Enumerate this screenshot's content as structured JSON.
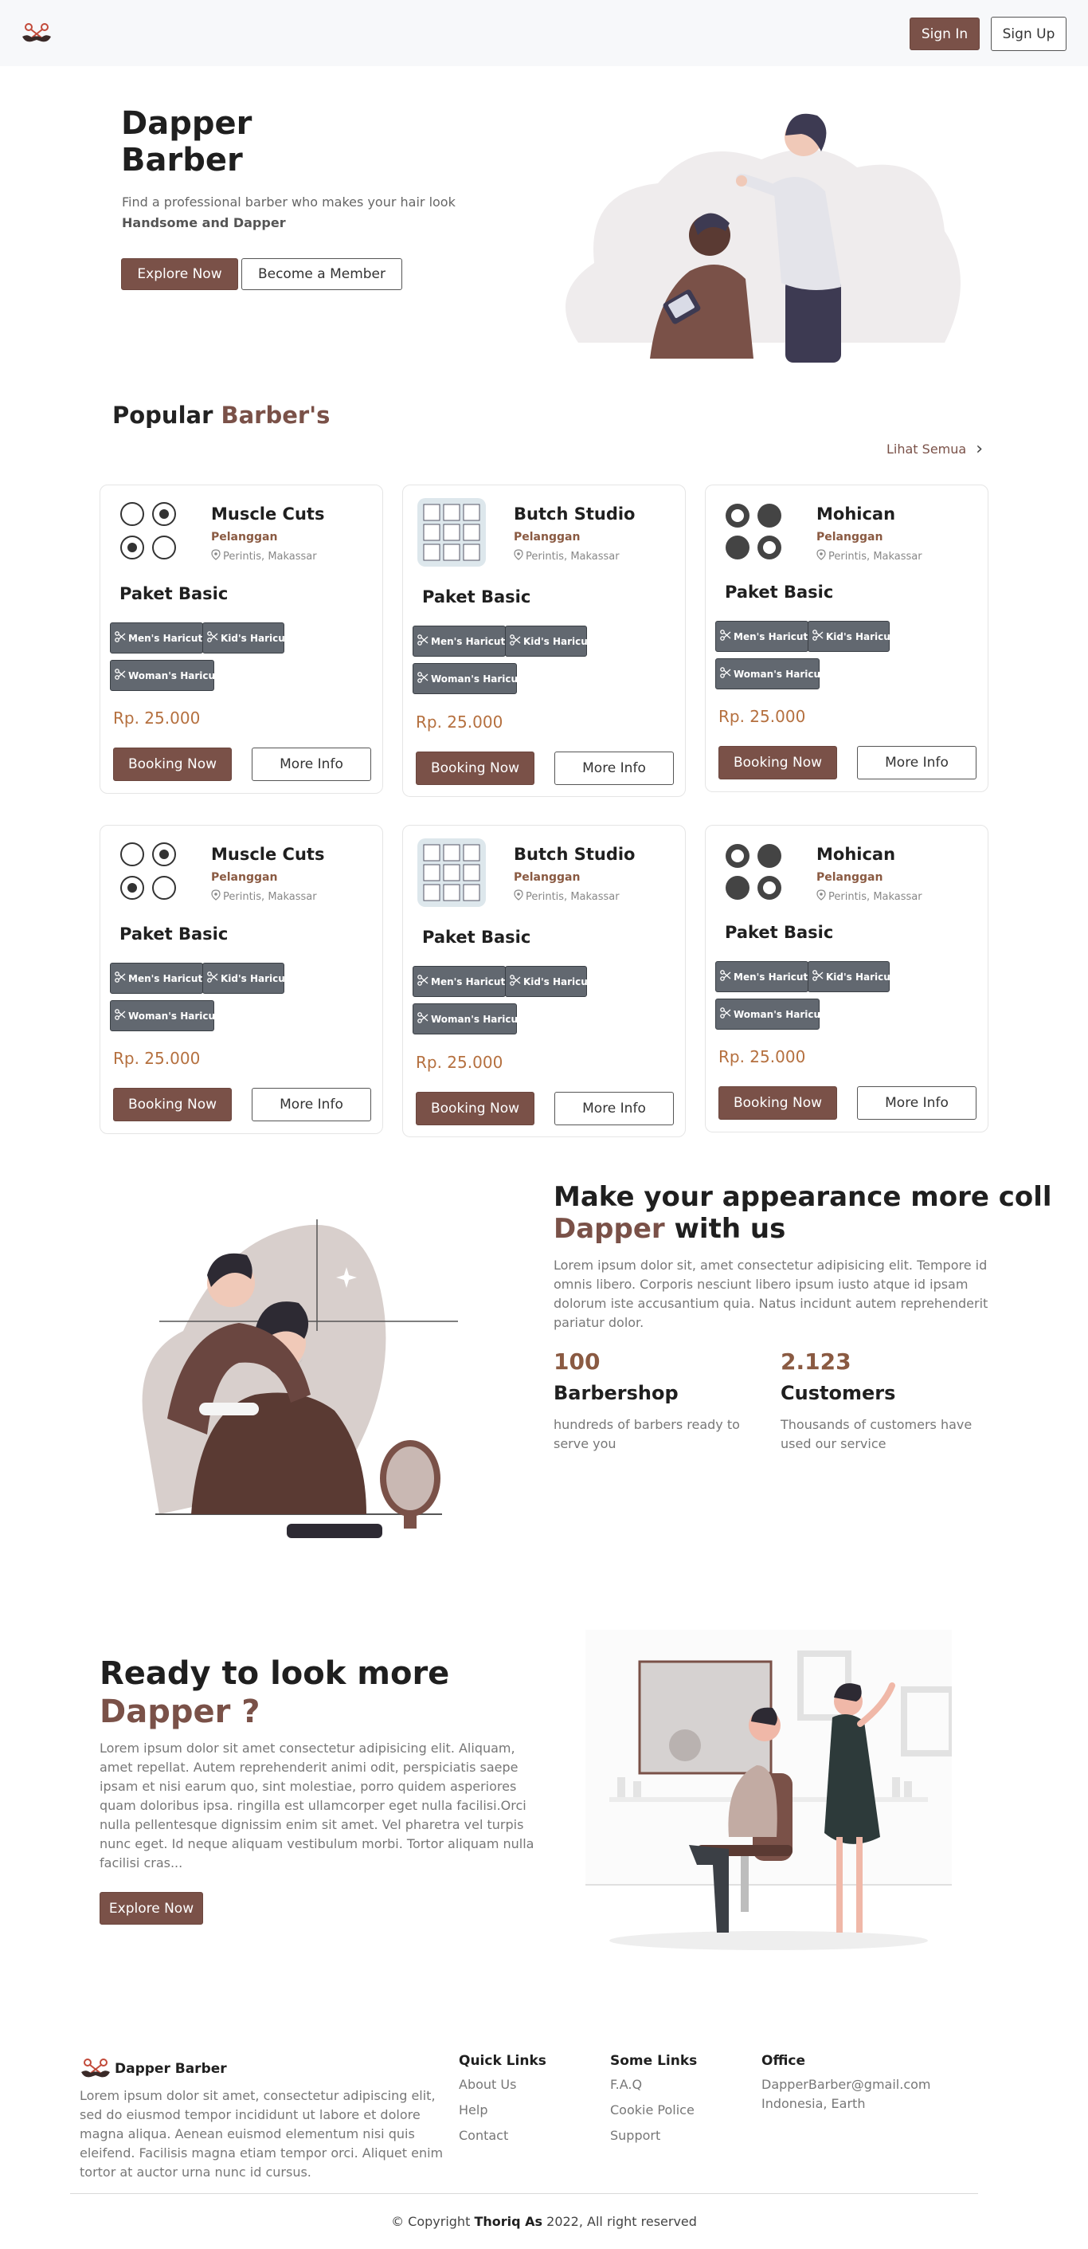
{
  "nav": {
    "signin_label": "Sign In",
    "signup_label": "Sign Up",
    "logo_icon": "mustache-scissors-icon"
  },
  "hero": {
    "title_line1": "Dapper",
    "title_line2": "Barber",
    "subtitle": "Find a professional barber who makes your hair look",
    "subtitle_strong": "Handsome and Dapper",
    "explore_label": "Explore Now",
    "member_label": "Become a Member"
  },
  "popular": {
    "title_plain": "Popular ",
    "title_accent": "Barber's",
    "see_all": "Lihat Semua"
  },
  "cards": [
    {
      "name": "Muscle Cuts",
      "category": "Pelanggan",
      "location": "Perintis, Makassar",
      "package": "Paket Basic",
      "tags": [
        "Men's Haricut",
        "Kid's Haricut",
        "Woman's Haricut"
      ],
      "price": "Rp. 25.000",
      "book": "Booking Now",
      "more": "More Info"
    },
    {
      "name": "Butch Studio",
      "category": "Pelanggan",
      "location": "Perintis, Makassar",
      "package": "Paket Basic",
      "tags": [
        "Men's Haricut",
        "Kid's Haricut",
        "Woman's Haricut"
      ],
      "price": "Rp. 25.000",
      "book": "Booking Now",
      "more": "More Info"
    },
    {
      "name": "Mohican",
      "category": "Pelanggan",
      "location": "Perintis, Makassar",
      "package": "Paket Basic",
      "tags": [
        "Men's Haricut",
        "Kid's Haricut",
        "Woman's Haricut"
      ],
      "price": "Rp. 25.000",
      "book": "Booking Now",
      "more": "More Info"
    },
    {
      "name": "Muscle Cuts",
      "category": "Pelanggan",
      "location": "Perintis, Makassar",
      "package": "Paket Basic",
      "tags": [
        "Men's Haricut",
        "Kid's Haricut",
        "Woman's Haricut"
      ],
      "price": "Rp. 25.000",
      "book": "Booking Now",
      "more": "More Info"
    },
    {
      "name": "Butch Studio",
      "category": "Pelanggan",
      "location": "Perintis, Makassar",
      "package": "Paket Basic",
      "tags": [
        "Men's Haricut",
        "Kid's Haricut",
        "Woman's Haricut"
      ],
      "price": "Rp. 25.000",
      "book": "Booking Now",
      "more": "More Info"
    },
    {
      "name": "Mohican",
      "category": "Pelanggan",
      "location": "Perintis, Makassar",
      "package": "Paket Basic",
      "tags": [
        "Men's Haricut",
        "Kid's Haricut",
        "Woman's Haricut"
      ],
      "price": "Rp. 25.000",
      "book": "Booking Now",
      "more": "More Info"
    }
  ],
  "appearance": {
    "title_line1": "Make your appearance more coll",
    "title_accent": "Dapper",
    "title_rest": " with us",
    "text": "Lorem ipsum dolor sit, amet consectetur adipisicing elit. Tempore id omnis libero. Corporis nesciunt libero ipsum iusto atque id ipsam dolorum iste accusantium quia. Natus incidunt autem reprehenderit pariatur dolor.",
    "stats": [
      {
        "number": "100",
        "label": "Barbershop",
        "desc": "hundreds of barbers ready to serve you"
      },
      {
        "number": "2.123",
        "label": "Customers",
        "desc": "Thousands of customers have used our service"
      }
    ]
  },
  "ready": {
    "title_line1": "Ready to look more",
    "title_accent": "Dapper ?",
    "text": "Lorem ipsum dolor sit amet consectetur adipisicing elit. Aliquam, amet repellat. Autem reprehenderit animi odit, perspiciatis saepe ipsam et nisi earum quo, sint molestiae, porro quidem asperiores quam doloribus ipsa. ringilla est ullamcorper eget nulla facilisi.Orci nulla pellentesque dignissim enim sit amet. Vel pharetra vel turpis nunc eget. Id neque aliquam vestibulum morbi. Tortor aliquam nulla facilisi cras...",
    "button": "Explore Now"
  },
  "footer": {
    "brand": "Dapper Barber",
    "about": "Lorem ipsum dolor sit amet, consectetur adipiscing elit, sed do eiusmod tempor incididunt ut labore et dolore magna aliqua. Aenean euismod elementum nisi quis eleifend. Facilisis magna etiam tempor orci. Aliquet enim tortor at auctor urna nunc id cursus.",
    "quick_title": "Quick Links",
    "quick_links": [
      "About Us",
      "Help",
      "Contact"
    ],
    "some_title": "Some Links",
    "some_links": [
      "F.A.Q",
      "Cookie Police",
      "Support"
    ],
    "office_title": "Office",
    "office_email": "DapperBarber@gmail.com",
    "office_location": "Indonesia, Earth",
    "copyright_pre": "© Copyright ",
    "copyright_name": "Thoriq As",
    "copyright_post": " 2022, All right reserved"
  },
  "colors": {
    "accent": "#7a5148",
    "price": "#b5703f",
    "tag": "#626870",
    "nav_bg": "#f7f8fa"
  }
}
